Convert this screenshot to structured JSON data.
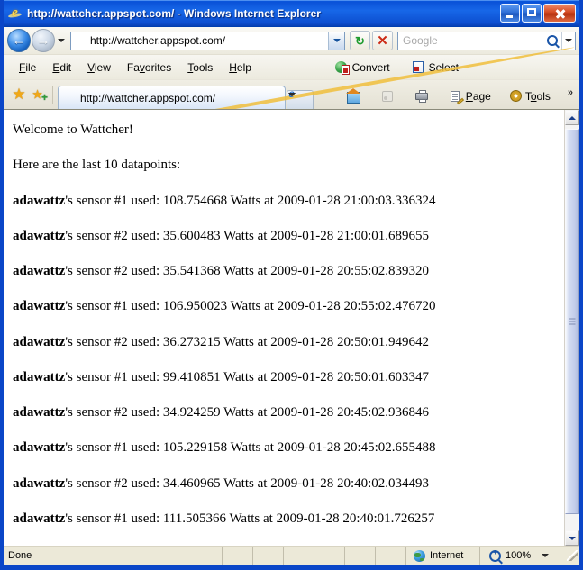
{
  "window": {
    "title": "http://wattcher.appspot.com/ - Windows Internet Explorer",
    "minimize_label": "Minimize",
    "maximize_label": "Maximize",
    "close_label": "Close"
  },
  "navigation": {
    "back_label": "Back",
    "back_glyph": "←",
    "forward_label": "Forward",
    "forward_glyph": "→",
    "recent_pages_label": "Recent Pages",
    "address_url": "http://wattcher.appspot.com/",
    "refresh_glyph": "↻",
    "refresh_label": "Refresh",
    "stop_glyph": "✕",
    "stop_label": "Stop",
    "search_placeholder": "Google",
    "search_value": "",
    "search_go_label": "Search",
    "search_provider_label": "Change search defaults"
  },
  "menubar": {
    "items": [
      {
        "pre": "",
        "key": "F",
        "post": "ile"
      },
      {
        "pre": "",
        "key": "E",
        "post": "dit"
      },
      {
        "pre": "",
        "key": "V",
        "post": "iew"
      },
      {
        "pre": "Fa",
        "key": "v",
        "post": "orites"
      },
      {
        "pre": "",
        "key": "T",
        "post": "ools"
      },
      {
        "pre": "",
        "key": "H",
        "post": "elp"
      }
    ]
  },
  "pdf_toolbar": {
    "convert_label": "Convert",
    "select_label": "Select"
  },
  "tabs": {
    "favorites_center_label": "Favorites Center",
    "add_favorite_label": "Add to Favorites",
    "items": [
      {
        "label": "http://wattcher.appspot.com/",
        "active": true
      }
    ],
    "new_tab_label": "New Tab"
  },
  "command_bar": {
    "home_label": "Home",
    "feeds_label": "Feeds",
    "print_label": "Print",
    "page_label": "Page",
    "page_key": "P",
    "tools_label": "Tools",
    "tools_key": "o",
    "overflow_label": "»"
  },
  "page": {
    "heading": "Welcome to Wattcher!",
    "subheading": "Here are the last 10 datapoints:",
    "datapoints": [
      {
        "user": "adawattz",
        "text": "'s sensor #1 used: 108.754668 Watts at 2009-01-28 21:00:03.336324",
        "sensor": 1,
        "watts": 108.754668,
        "timestamp": "2009-01-28 21:00:03.336324"
      },
      {
        "user": "adawattz",
        "text": "'s sensor #2 used: 35.600483 Watts at 2009-01-28 21:00:01.689655",
        "sensor": 2,
        "watts": 35.600483,
        "timestamp": "2009-01-28 21:00:01.689655"
      },
      {
        "user": "adawattz",
        "text": "'s sensor #2 used: 35.541368 Watts at 2009-01-28 20:55:02.839320",
        "sensor": 2,
        "watts": 35.541368,
        "timestamp": "2009-01-28 20:55:02.839320"
      },
      {
        "user": "adawattz",
        "text": "'s sensor #1 used: 106.950023 Watts at 2009-01-28 20:55:02.476720",
        "sensor": 1,
        "watts": 106.950023,
        "timestamp": "2009-01-28 20:55:02.476720"
      },
      {
        "user": "adawattz",
        "text": "'s sensor #2 used: 36.273215 Watts at 2009-01-28 20:50:01.949642",
        "sensor": 2,
        "watts": 36.273215,
        "timestamp": "2009-01-28 20:50:01.949642"
      },
      {
        "user": "adawattz",
        "text": "'s sensor #1 used: 99.410851 Watts at 2009-01-28 20:50:01.603347",
        "sensor": 1,
        "watts": 99.410851,
        "timestamp": "2009-01-28 20:50:01.603347"
      },
      {
        "user": "adawattz",
        "text": "'s sensor #2 used: 34.924259 Watts at 2009-01-28 20:45:02.936846",
        "sensor": 2,
        "watts": 34.924259,
        "timestamp": "2009-01-28 20:45:02.936846"
      },
      {
        "user": "adawattz",
        "text": "'s sensor #1 used: 105.229158 Watts at 2009-01-28 20:45:02.655488",
        "sensor": 1,
        "watts": 105.229158,
        "timestamp": "2009-01-28 20:45:02.655488"
      },
      {
        "user": "adawattz",
        "text": "'s sensor #2 used: 34.460965 Watts at 2009-01-28 20:40:02.034493",
        "sensor": 2,
        "watts": 34.460965,
        "timestamp": "2009-01-28 20:40:02.034493"
      },
      {
        "user": "adawattz",
        "text": "'s sensor #1 used: 111.505366 Watts at 2009-01-28 20:40:01.726257",
        "sensor": 1,
        "watts": 111.505366,
        "timestamp": "2009-01-28 20:40:01.726257"
      }
    ]
  },
  "scrollbar": {
    "up_label": "Scroll up",
    "down_label": "Scroll down"
  },
  "statusbar": {
    "status_text": "Done",
    "zone_text": "Internet",
    "zoom_text": "100%"
  },
  "colors": {
    "window_frame": "#0a46c8",
    "title_gradient_start": "#1767e8",
    "chrome_bg": "#f4f2ea",
    "status_bg": "#ece9d8",
    "content_bg": "#ffffff",
    "link_blue": "#1c6fd0"
  }
}
